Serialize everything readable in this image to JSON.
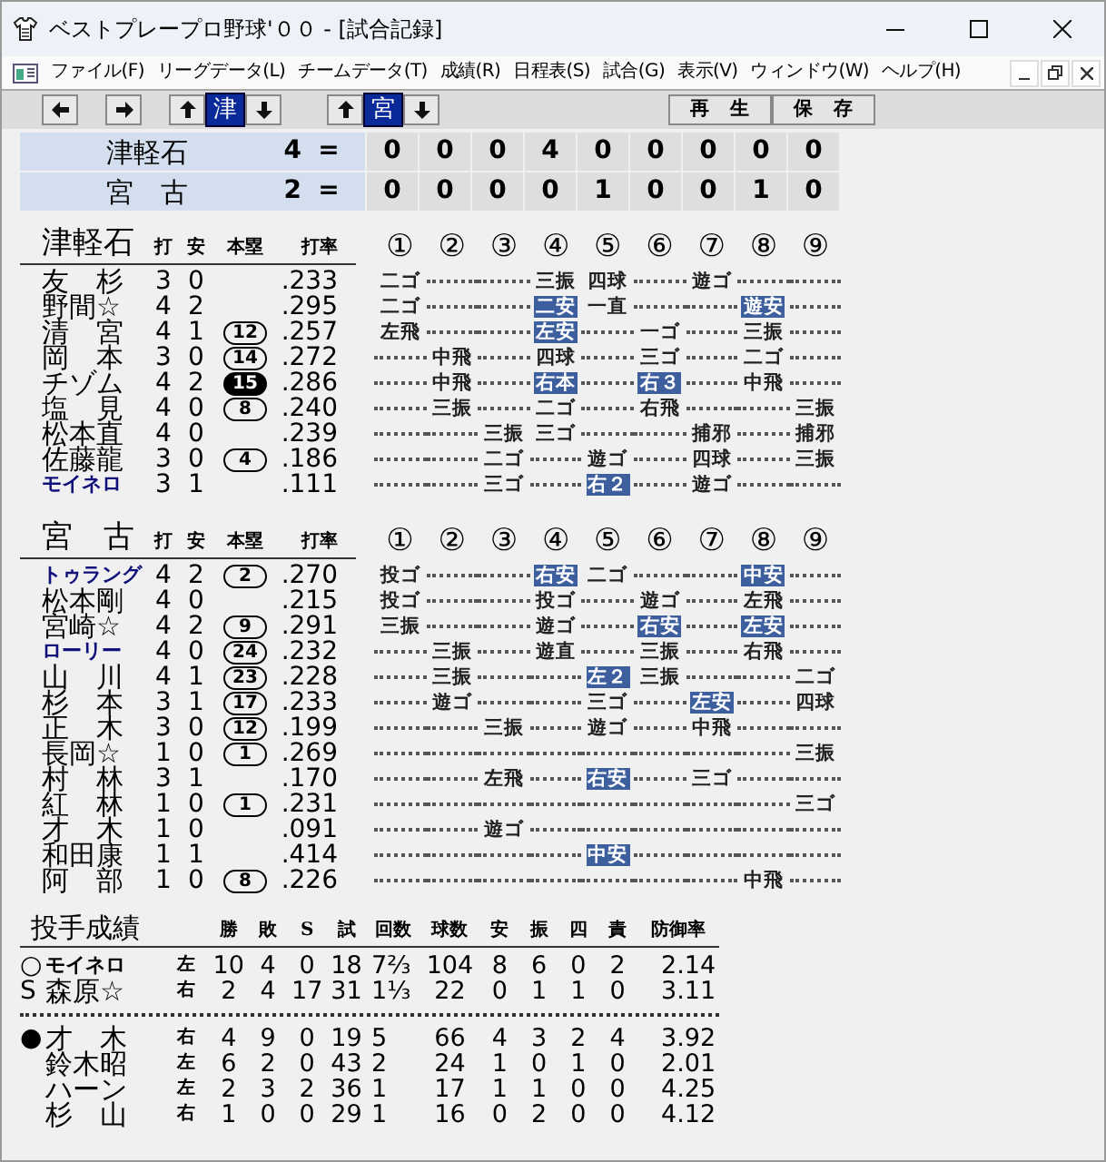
{
  "window": {
    "title": "ベストプレープロ野球'００ - [試合記録]"
  },
  "menu": [
    "ファイル(F)",
    "リーグデータ(L)",
    "チームデータ(T)",
    "成績(R)",
    "日程表(S)",
    "試合(G)",
    "表示(V)",
    "ウィンドウ(W)",
    "ヘルプ(H)"
  ],
  "toolbar": {
    "team_pickers": [
      {
        "label": "津",
        "selected": true
      },
      {
        "label": "宮",
        "selected": true
      }
    ],
    "buttons": [
      "再　生",
      "保　存"
    ]
  },
  "scoreboard": [
    {
      "team": "津軽石",
      "total": "4",
      "separator": "=",
      "innings": [
        "0",
        "0",
        "0",
        "4",
        "0",
        "0",
        "0",
        "0",
        "0"
      ]
    },
    {
      "team": "宮　古",
      "total": "2",
      "separator": "=",
      "innings": [
        "0",
        "0",
        "0",
        "0",
        "1",
        "0",
        "0",
        "1",
        "0"
      ]
    }
  ],
  "batting": [
    {
      "team": "津軽石",
      "columns": [
        "打",
        "安",
        "本塁",
        "打率"
      ],
      "innings_header": [
        "①",
        "②",
        "③",
        "④",
        "⑤",
        "⑥",
        "⑦",
        "⑧",
        "⑨"
      ],
      "batters": [
        {
          "name": "友　杉",
          "foreign": false,
          "ab": "3",
          "h": "0",
          "avg": ".233",
          "innings": [
            {
              "kind": "result",
              "text": "二ゴ",
              "hit": false
            },
            {
              "kind": "leader"
            },
            {
              "kind": "leader"
            },
            {
              "kind": "result",
              "text": "三振",
              "hit": false
            },
            {
              "kind": "result",
              "text": "四球",
              "hit": false
            },
            {
              "kind": "leader"
            },
            {
              "kind": "result",
              "text": "遊ゴ",
              "hit": false
            },
            {
              "kind": "leader"
            },
            {
              "kind": "leader"
            }
          ]
        },
        {
          "name": "野間☆",
          "foreign": false,
          "ab": "4",
          "h": "2",
          "avg": ".295",
          "innings": [
            {
              "kind": "result",
              "text": "二ゴ",
              "hit": false
            },
            {
              "kind": "leader"
            },
            {
              "kind": "leader"
            },
            {
              "kind": "result",
              "text": "二安",
              "hit": true
            },
            {
              "kind": "result",
              "text": "一直",
              "hit": false
            },
            {
              "kind": "leader"
            },
            {
              "kind": "leader"
            },
            {
              "kind": "result",
              "text": "遊安",
              "hit": true
            },
            {
              "kind": "leader"
            }
          ]
        },
        {
          "name": "清　宮",
          "foreign": false,
          "ab": "4",
          "h": "1",
          "hr": {
            "text": "12",
            "filled": false
          },
          "avg": ".257",
          "innings": [
            {
              "kind": "result",
              "text": "左飛",
              "hit": false
            },
            {
              "kind": "leader"
            },
            {
              "kind": "leader"
            },
            {
              "kind": "result",
              "text": "左安",
              "hit": true
            },
            {
              "kind": "leader"
            },
            {
              "kind": "result",
              "text": "一ゴ",
              "hit": false
            },
            {
              "kind": "leader"
            },
            {
              "kind": "result",
              "text": "三振",
              "hit": false
            },
            {
              "kind": "leader"
            }
          ]
        },
        {
          "name": "岡　本",
          "foreign": false,
          "ab": "3",
          "h": "0",
          "hr": {
            "text": "14",
            "filled": false
          },
          "avg": ".272",
          "innings": [
            {
              "kind": "leader"
            },
            {
              "kind": "result",
              "text": "中飛",
              "hit": false
            },
            {
              "kind": "leader"
            },
            {
              "kind": "result",
              "text": "四球",
              "hit": false
            },
            {
              "kind": "leader"
            },
            {
              "kind": "result",
              "text": "三ゴ",
              "hit": false
            },
            {
              "kind": "leader"
            },
            {
              "kind": "result",
              "text": "二ゴ",
              "hit": false
            },
            {
              "kind": "leader"
            }
          ]
        },
        {
          "name": "チゾム",
          "foreign": false,
          "ab": "4",
          "h": "2",
          "hr": {
            "text": "15",
            "filled": true
          },
          "avg": ".286",
          "innings": [
            {
              "kind": "leader"
            },
            {
              "kind": "result",
              "text": "中飛",
              "hit": false
            },
            {
              "kind": "leader"
            },
            {
              "kind": "result",
              "text": "右本",
              "hit": true
            },
            {
              "kind": "leader"
            },
            {
              "kind": "result",
              "text": "右３",
              "hit": true
            },
            {
              "kind": "leader"
            },
            {
              "kind": "result",
              "text": "中飛",
              "hit": false
            },
            {
              "kind": "leader"
            }
          ]
        },
        {
          "name": "塩　見",
          "foreign": false,
          "ab": "4",
          "h": "0",
          "hr": {
            "text": "8",
            "filled": false
          },
          "avg": ".240",
          "innings": [
            {
              "kind": "leader"
            },
            {
              "kind": "result",
              "text": "三振",
              "hit": false
            },
            {
              "kind": "leader"
            },
            {
              "kind": "result",
              "text": "二ゴ",
              "hit": false
            },
            {
              "kind": "leader"
            },
            {
              "kind": "result",
              "text": "右飛",
              "hit": false
            },
            {
              "kind": "leader"
            },
            {
              "kind": "leader"
            },
            {
              "kind": "result",
              "text": "三振",
              "hit": false
            }
          ]
        },
        {
          "name": "松本直",
          "foreign": false,
          "ab": "4",
          "h": "0",
          "avg": ".239",
          "innings": [
            {
              "kind": "leader"
            },
            {
              "kind": "leader"
            },
            {
              "kind": "result",
              "text": "三振",
              "hit": false
            },
            {
              "kind": "result",
              "text": "三ゴ",
              "hit": false
            },
            {
              "kind": "leader"
            },
            {
              "kind": "leader"
            },
            {
              "kind": "result",
              "text": "捕邪",
              "hit": false
            },
            {
              "kind": "leader"
            },
            {
              "kind": "result",
              "text": "捕邪",
              "hit": false
            }
          ]
        },
        {
          "name": "佐藤龍",
          "foreign": false,
          "ab": "3",
          "h": "0",
          "hr": {
            "text": "4",
            "filled": false
          },
          "avg": ".186",
          "innings": [
            {
              "kind": "leader"
            },
            {
              "kind": "leader"
            },
            {
              "kind": "result",
              "text": "二ゴ",
              "hit": false
            },
            {
              "kind": "leader"
            },
            {
              "kind": "result",
              "text": "遊ゴ",
              "hit": false
            },
            {
              "kind": "leader"
            },
            {
              "kind": "result",
              "text": "四球",
              "hit": false
            },
            {
              "kind": "leader"
            },
            {
              "kind": "result",
              "text": "三振",
              "hit": false
            }
          ]
        },
        {
          "name": "モイネロ",
          "foreign": true,
          "ab": "3",
          "h": "1",
          "avg": ".111",
          "innings": [
            {
              "kind": "leader"
            },
            {
              "kind": "leader"
            },
            {
              "kind": "result",
              "text": "三ゴ",
              "hit": false
            },
            {
              "kind": "leader"
            },
            {
              "kind": "result",
              "text": "右２",
              "hit": true
            },
            {
              "kind": "leader"
            },
            {
              "kind": "result",
              "text": "遊ゴ",
              "hit": false
            },
            {
              "kind": "leader"
            },
            {
              "kind": "leader"
            }
          ]
        }
      ]
    },
    {
      "team": "宮　古",
      "columns": [
        "打",
        "安",
        "本塁",
        "打率"
      ],
      "innings_header": [
        "①",
        "②",
        "③",
        "④",
        "⑤",
        "⑥",
        "⑦",
        "⑧",
        "⑨"
      ],
      "batters": [
        {
          "name": "トゥラング",
          "foreign": true,
          "ab": "4",
          "h": "2",
          "hr": {
            "text": "2",
            "filled": false
          },
          "avg": ".270",
          "innings": [
            {
              "kind": "result",
              "text": "投ゴ",
              "hit": false
            },
            {
              "kind": "leader"
            },
            {
              "kind": "leader"
            },
            {
              "kind": "result",
              "text": "右安",
              "hit": true
            },
            {
              "kind": "result",
              "text": "二ゴ",
              "hit": false
            },
            {
              "kind": "leader"
            },
            {
              "kind": "leader"
            },
            {
              "kind": "result",
              "text": "中安",
              "hit": true
            },
            {
              "kind": "leader"
            }
          ]
        },
        {
          "name": "松本剛",
          "foreign": false,
          "ab": "4",
          "h": "0",
          "avg": ".215",
          "innings": [
            {
              "kind": "result",
              "text": "投ゴ",
              "hit": false
            },
            {
              "kind": "leader"
            },
            {
              "kind": "leader"
            },
            {
              "kind": "result",
              "text": "投ゴ",
              "hit": false
            },
            {
              "kind": "leader"
            },
            {
              "kind": "result",
              "text": "遊ゴ",
              "hit": false
            },
            {
              "kind": "leader"
            },
            {
              "kind": "result",
              "text": "左飛",
              "hit": false
            },
            {
              "kind": "leader"
            }
          ]
        },
        {
          "name": "宮崎☆",
          "foreign": false,
          "ab": "4",
          "h": "2",
          "hr": {
            "text": "9",
            "filled": false
          },
          "avg": ".291",
          "innings": [
            {
              "kind": "result",
              "text": "三振",
              "hit": false
            },
            {
              "kind": "leader"
            },
            {
              "kind": "leader"
            },
            {
              "kind": "result",
              "text": "遊ゴ",
              "hit": false
            },
            {
              "kind": "leader"
            },
            {
              "kind": "result",
              "text": "右安",
              "hit": true
            },
            {
              "kind": "leader"
            },
            {
              "kind": "result",
              "text": "左安",
              "hit": true
            },
            {
              "kind": "leader"
            }
          ]
        },
        {
          "name": "ローリー",
          "foreign": true,
          "ab": "4",
          "h": "0",
          "hr": {
            "text": "24",
            "filled": false
          },
          "avg": ".232",
          "innings": [
            {
              "kind": "leader"
            },
            {
              "kind": "result",
              "text": "三振",
              "hit": false
            },
            {
              "kind": "leader"
            },
            {
              "kind": "result",
              "text": "遊直",
              "hit": false
            },
            {
              "kind": "leader"
            },
            {
              "kind": "result",
              "text": "三振",
              "hit": false
            },
            {
              "kind": "leader"
            },
            {
              "kind": "result",
              "text": "右飛",
              "hit": false
            },
            {
              "kind": "leader"
            }
          ]
        },
        {
          "name": "山　川",
          "foreign": false,
          "ab": "4",
          "h": "1",
          "hr": {
            "text": "23",
            "filled": false
          },
          "avg": ".228",
          "innings": [
            {
              "kind": "leader"
            },
            {
              "kind": "result",
              "text": "三振",
              "hit": false
            },
            {
              "kind": "leader"
            },
            {
              "kind": "leader"
            },
            {
              "kind": "result",
              "text": "左２",
              "hit": true
            },
            {
              "kind": "result",
              "text": "三振",
              "hit": false
            },
            {
              "kind": "leader"
            },
            {
              "kind": "leader"
            },
            {
              "kind": "result",
              "text": "二ゴ",
              "hit": false
            }
          ]
        },
        {
          "name": "杉　本",
          "foreign": false,
          "ab": "3",
          "h": "1",
          "hr": {
            "text": "17",
            "filled": false
          },
          "avg": ".233",
          "innings": [
            {
              "kind": "leader"
            },
            {
              "kind": "result",
              "text": "遊ゴ",
              "hit": false
            },
            {
              "kind": "leader"
            },
            {
              "kind": "leader"
            },
            {
              "kind": "result",
              "text": "三ゴ",
              "hit": false
            },
            {
              "kind": "leader"
            },
            {
              "kind": "result",
              "text": "左安",
              "hit": true
            },
            {
              "kind": "leader"
            },
            {
              "kind": "result",
              "text": "四球",
              "hit": false
            }
          ]
        },
        {
          "name": "正　木",
          "foreign": false,
          "ab": "3",
          "h": "0",
          "hr": {
            "text": "12",
            "filled": false
          },
          "avg": ".199",
          "innings": [
            {
              "kind": "leader"
            },
            {
              "kind": "leader"
            },
            {
              "kind": "result",
              "text": "三振",
              "hit": false
            },
            {
              "kind": "leader"
            },
            {
              "kind": "result",
              "text": "遊ゴ",
              "hit": false
            },
            {
              "kind": "leader"
            },
            {
              "kind": "result",
              "text": "中飛",
              "hit": false
            },
            {
              "kind": "leader"
            },
            {
              "kind": "leader"
            }
          ]
        },
        {
          "name": "長岡☆",
          "foreign": false,
          "ab": "1",
          "h": "0",
          "hr": {
            "text": "1",
            "filled": false
          },
          "avg": ".269",
          "innings": [
            {
              "kind": "leader"
            },
            {
              "kind": "leader"
            },
            {
              "kind": "leader"
            },
            {
              "kind": "leader"
            },
            {
              "kind": "leader"
            },
            {
              "kind": "leader"
            },
            {
              "kind": "leader"
            },
            {
              "kind": "leader"
            },
            {
              "kind": "result",
              "text": "三振",
              "hit": false
            }
          ]
        },
        {
          "name": "村　林",
          "foreign": false,
          "ab": "3",
          "h": "1",
          "avg": ".170",
          "innings": [
            {
              "kind": "leader"
            },
            {
              "kind": "leader"
            },
            {
              "kind": "result",
              "text": "左飛",
              "hit": false
            },
            {
              "kind": "leader"
            },
            {
              "kind": "result",
              "text": "右安",
              "hit": true
            },
            {
              "kind": "leader"
            },
            {
              "kind": "result",
              "text": "三ゴ",
              "hit": false
            },
            {
              "kind": "leader"
            },
            {
              "kind": "leader"
            }
          ]
        },
        {
          "name": "紅　林",
          "foreign": false,
          "ab": "1",
          "h": "0",
          "hr": {
            "text": "1",
            "filled": false
          },
          "avg": ".231",
          "innings": [
            {
              "kind": "leader"
            },
            {
              "kind": "leader"
            },
            {
              "kind": "leader"
            },
            {
              "kind": "leader"
            },
            {
              "kind": "leader"
            },
            {
              "kind": "leader"
            },
            {
              "kind": "leader"
            },
            {
              "kind": "leader"
            },
            {
              "kind": "result",
              "text": "三ゴ",
              "hit": false
            }
          ]
        },
        {
          "name": "才　木",
          "foreign": false,
          "ab": "1",
          "h": "0",
          "avg": ".091",
          "innings": [
            {
              "kind": "leader"
            },
            {
              "kind": "leader"
            },
            {
              "kind": "result",
              "text": "遊ゴ",
              "hit": false
            },
            {
              "kind": "leader"
            },
            {
              "kind": "leader"
            },
            {
              "kind": "leader"
            },
            {
              "kind": "leader"
            },
            {
              "kind": "leader"
            },
            {
              "kind": "leader"
            }
          ]
        },
        {
          "name": "和田康",
          "foreign": false,
          "ab": "1",
          "h": "1",
          "avg": ".414",
          "innings": [
            {
              "kind": "leader"
            },
            {
              "kind": "leader"
            },
            {
              "kind": "leader"
            },
            {
              "kind": "leader"
            },
            {
              "kind": "result",
              "text": "中安",
              "hit": true
            },
            {
              "kind": "leader"
            },
            {
              "kind": "leader"
            },
            {
              "kind": "leader"
            },
            {
              "kind": "leader"
            }
          ]
        },
        {
          "name": "阿　部",
          "foreign": false,
          "ab": "1",
          "h": "0",
          "hr": {
            "text": "8",
            "filled": false
          },
          "avg": ".226",
          "innings": [
            {
              "kind": "leader"
            },
            {
              "kind": "leader"
            },
            {
              "kind": "leader"
            },
            {
              "kind": "leader"
            },
            {
              "kind": "leader"
            },
            {
              "kind": "leader"
            },
            {
              "kind": "leader"
            },
            {
              "kind": "result",
              "text": "中飛",
              "hit": false
            },
            {
              "kind": "leader"
            }
          ]
        }
      ]
    }
  ],
  "pitching": {
    "title": "投手成績",
    "columns": [
      "勝",
      "敗",
      "S",
      "試",
      "回数",
      "球数",
      "安",
      "振",
      "四",
      "責",
      "防御率"
    ],
    "groups": [
      [
        {
          "mark": "○",
          "name": "モイネロ",
          "foreign": true,
          "hand": "左",
          "stats": [
            "10",
            "4",
            "0",
            "18",
            "7⅔",
            "104",
            "8",
            "6",
            "0",
            "2",
            "2.14"
          ]
        },
        {
          "mark": "S",
          "name": "森原☆",
          "foreign": false,
          "hand": "右",
          "stats": [
            "2",
            "4",
            "17",
            "31",
            "1⅓",
            "22",
            "0",
            "1",
            "1",
            "0",
            "3.11"
          ]
        }
      ],
      [
        {
          "mark": "●",
          "name": "才　木",
          "foreign": false,
          "hand": "右",
          "stats": [
            "4",
            "9",
            "0",
            "19",
            "5",
            "66",
            "4",
            "3",
            "2",
            "4",
            "3.92"
          ]
        },
        {
          "name": "鈴木昭",
          "foreign": false,
          "hand": "左",
          "stats": [
            "6",
            "2",
            "0",
            "43",
            "2",
            "24",
            "1",
            "0",
            "1",
            "0",
            "2.01"
          ]
        },
        {
          "name": "ハーン",
          "foreign": false,
          "hand": "左",
          "stats": [
            "2",
            "3",
            "2",
            "36",
            "1",
            "17",
            "1",
            "1",
            "0",
            "0",
            "4.25"
          ]
        },
        {
          "name": "杉　山",
          "foreign": false,
          "hand": "右",
          "stats": [
            "1",
            "0",
            "0",
            "29",
            "1",
            "16",
            "0",
            "2",
            "0",
            "0",
            "4.12"
          ]
        }
      ]
    ]
  }
}
